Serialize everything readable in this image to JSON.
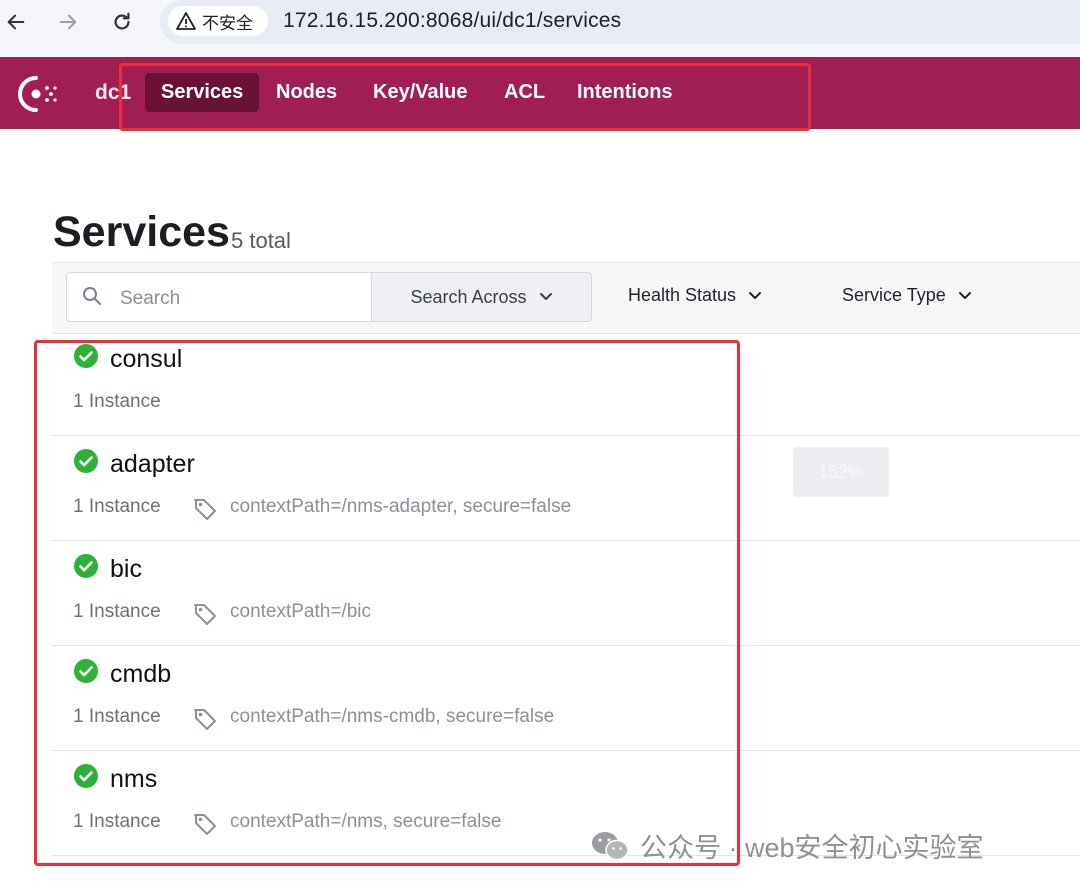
{
  "browser": {
    "security_label": "不安全",
    "url": "172.16.15.200:8068/ui/dc1/services"
  },
  "topnav": {
    "datacenter": "dc1",
    "items": [
      {
        "label": "Services",
        "active": true
      },
      {
        "label": "Nodes",
        "active": false
      },
      {
        "label": "Key/Value",
        "active": false
      },
      {
        "label": "ACL",
        "active": false
      },
      {
        "label": "Intentions",
        "active": false
      }
    ]
  },
  "page": {
    "title": "Services",
    "total": "5 total"
  },
  "filters": {
    "search_placeholder": "Search",
    "search_across": "Search Across",
    "health_status": "Health Status",
    "service_type": "Service Type"
  },
  "services": [
    {
      "name": "consul",
      "instances": "1 Instance",
      "tags": ""
    },
    {
      "name": "adapter",
      "instances": "1 Instance",
      "tags": "contextPath=/nms-adapter, secure=false"
    },
    {
      "name": "bic",
      "instances": "1 Instance",
      "tags": "contextPath=/bic"
    },
    {
      "name": "cmdb",
      "instances": "1 Instance",
      "tags": "contextPath=/nms-cmdb, secure=false"
    },
    {
      "name": "nms",
      "instances": "1 Instance",
      "tags": "contextPath=/nms, secure=false"
    }
  ],
  "ghost_button_label": "152%",
  "watermark": "公众号 · web安全初心实验室",
  "colors": {
    "nav_bg": "#a11e55",
    "nav_active": "#6a1235",
    "healthy": "#2eb039",
    "highlight": "#e8303a"
  }
}
